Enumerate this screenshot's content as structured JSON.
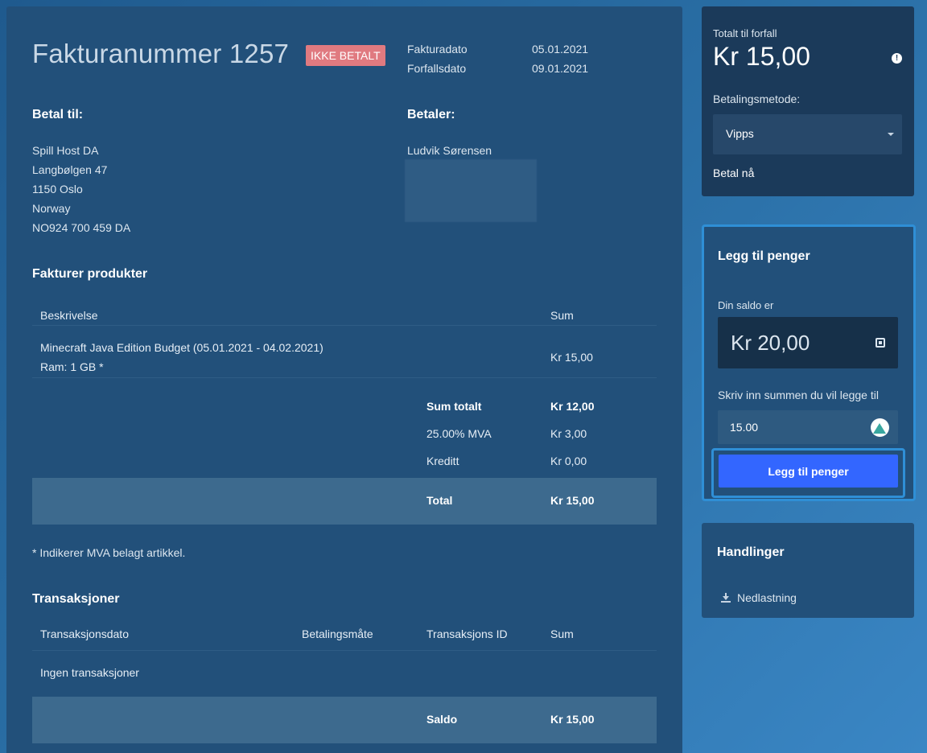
{
  "invoice": {
    "title": "Fakturanummer 1257",
    "status_badge": "IKKE BETALT",
    "invoice_date_label": "Fakturadato",
    "invoice_date": "05.01.2021",
    "due_date_label": "Forfallsdato",
    "due_date": "09.01.2021"
  },
  "pay_to": {
    "heading": "Betal til:",
    "lines": [
      "Spill Host DA",
      "Langbølgen 47",
      "1150 Oslo",
      "Norway",
      "NO924 700 459 DA"
    ]
  },
  "payer": {
    "heading": "Betaler:",
    "name": "Ludvik Sørensen"
  },
  "products": {
    "heading": "Fakturer produkter",
    "col_description": "Beskrivelse",
    "col_sum": "Sum",
    "items": [
      {
        "line1": "Minecraft Java Edition Budget (05.01.2021 - 04.02.2021)",
        "line2": "Ram: 1 GB *",
        "sum": "Kr 15,00"
      }
    ],
    "subtotal_label": "Sum totalt",
    "subtotal": "Kr 12,00",
    "vat_label": "25.00% MVA",
    "vat": "Kr 3,00",
    "credit_label": "Kreditt",
    "credit": "Kr 0,00",
    "total_label": "Total",
    "total": "Kr 15,00"
  },
  "vat_note": "* Indikerer MVA belagt artikkel.",
  "transactions": {
    "heading": "Transaksjoner",
    "col_date": "Transaksjonsdato",
    "col_method": "Betalingsmåte",
    "col_id": "Transaksjons ID",
    "col_sum": "Sum",
    "empty_text": "Ingen transaksjoner",
    "balance_label": "Saldo",
    "balance": "Kr 15,00"
  },
  "payment_panel": {
    "total_due_label": "Totalt til forfall",
    "total_due": "Kr 15,00",
    "method_label": "Betalingsmetode:",
    "method_selected": "Vipps",
    "pay_now": "Betal nå"
  },
  "add_funds": {
    "heading": "Legg til penger",
    "balance_label": "Din saldo er",
    "balance": "Kr 20,00",
    "amount_label": "Skriv inn summen du vil legge til",
    "amount_value": "15.00",
    "button": "Legg til penger"
  },
  "actions": {
    "heading": "Handlinger",
    "download": "Nedlastning"
  }
}
